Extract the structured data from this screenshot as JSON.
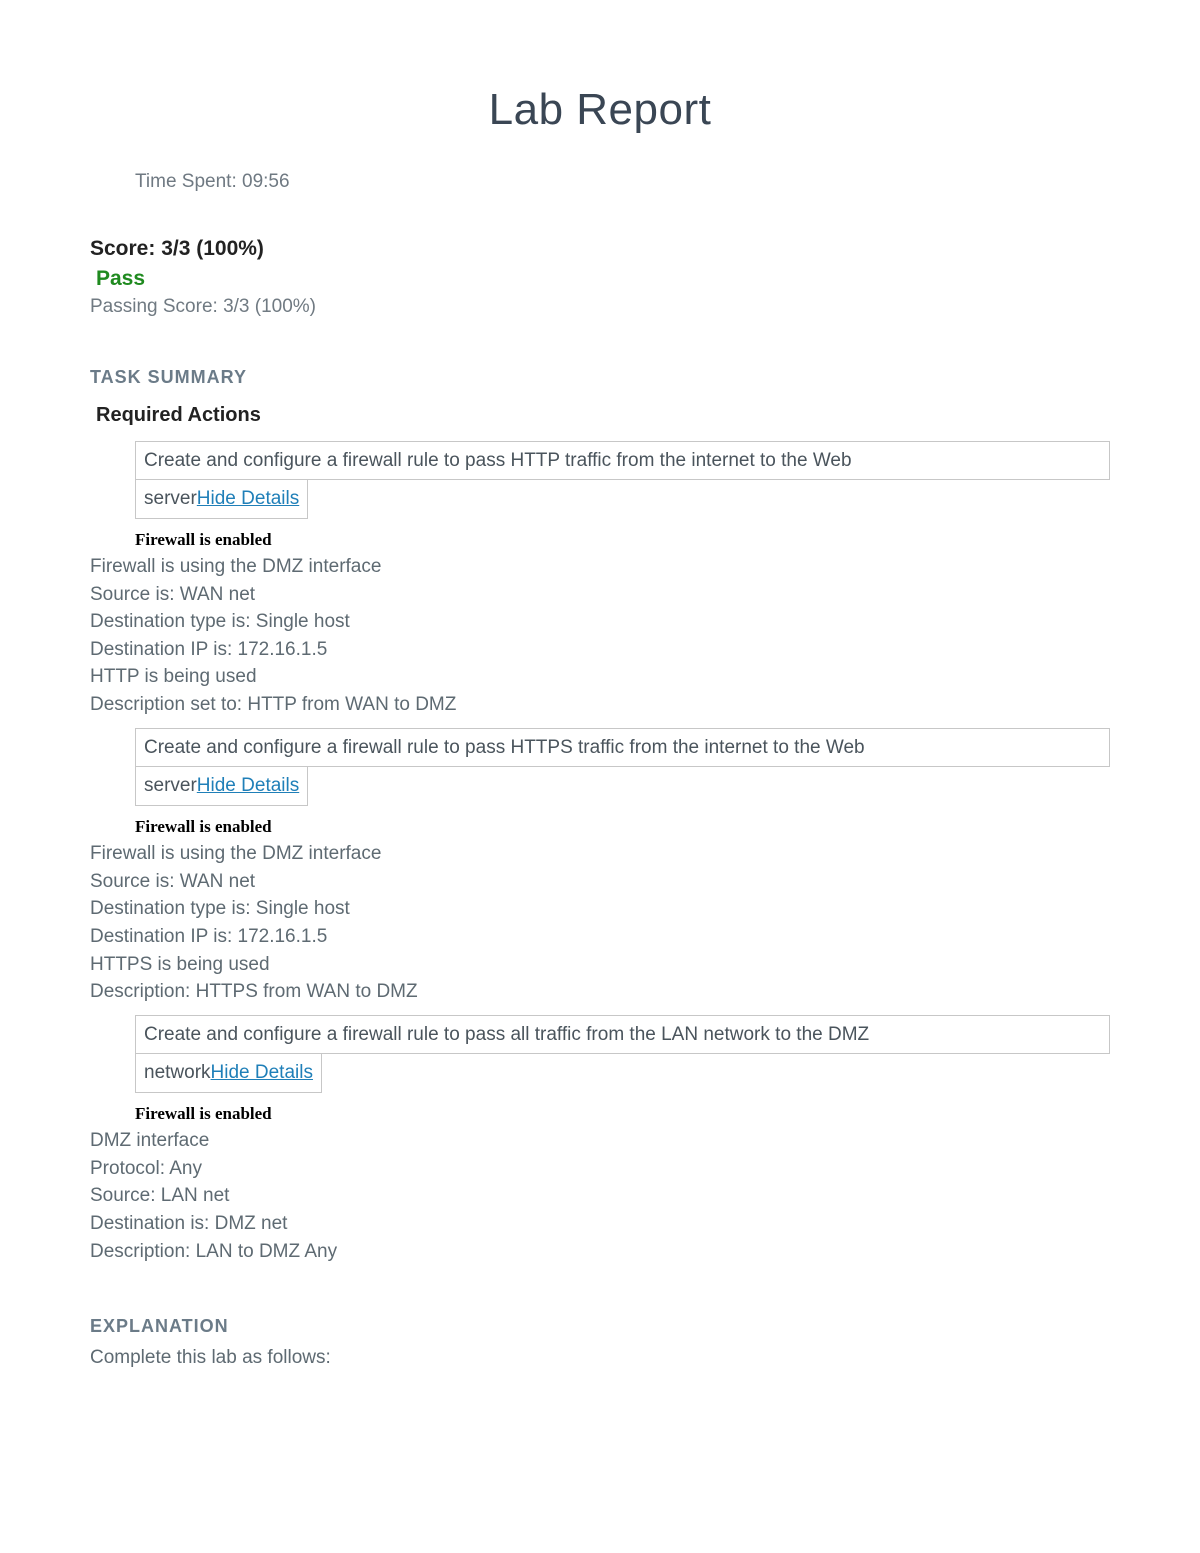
{
  "title": "Lab Report",
  "timeSpent": "Time Spent: 09:56",
  "scoreLine": "Score: 3/3 (100%)",
  "passLabel": "Pass",
  "passingScore": "Passing Score: 3/3 (100%)",
  "taskSummaryHeader": "TASK SUMMARY",
  "requiredActions": "Required Actions",
  "hideDetails": "Hide Details",
  "actions": [
    {
      "topLine": "Create and configure a firewall rule to pass HTTP traffic from the internet to the Web",
      "bottomPrefix": "server",
      "detailHead": "Firewall is enabled",
      "details": [
        "Firewall is using the DMZ interface",
        "Source is: WAN net",
        "Destination type is: Single host",
        "Destination IP is: 172.16.1.5",
        "HTTP is being used",
        "Description set to: HTTP from WAN to DMZ"
      ]
    },
    {
      "topLine": "Create and configure a firewall rule to pass HTTPS traffic from the internet to the Web",
      "bottomPrefix": "server",
      "detailHead": "Firewall is enabled",
      "details": [
        "Firewall is using the DMZ interface",
        "Source is: WAN net",
        "Destination type is: Single host",
        "Destination IP is: 172.16.1.5",
        "HTTPS is being used",
        "Description: HTTPS from WAN to DMZ"
      ]
    },
    {
      "topLine": "Create and configure a firewall rule to pass all traffic from the LAN network to the DMZ",
      "bottomPrefix": "network",
      "detailHead": "Firewall is enabled",
      "details": [
        "DMZ interface",
        "Protocol: Any",
        "Source: LAN net",
        "Destination is: DMZ net",
        "Description: LAN to DMZ Any"
      ]
    }
  ],
  "explanationHeader": "EXPLANATION",
  "explanationBody": "Complete this lab as follows:"
}
